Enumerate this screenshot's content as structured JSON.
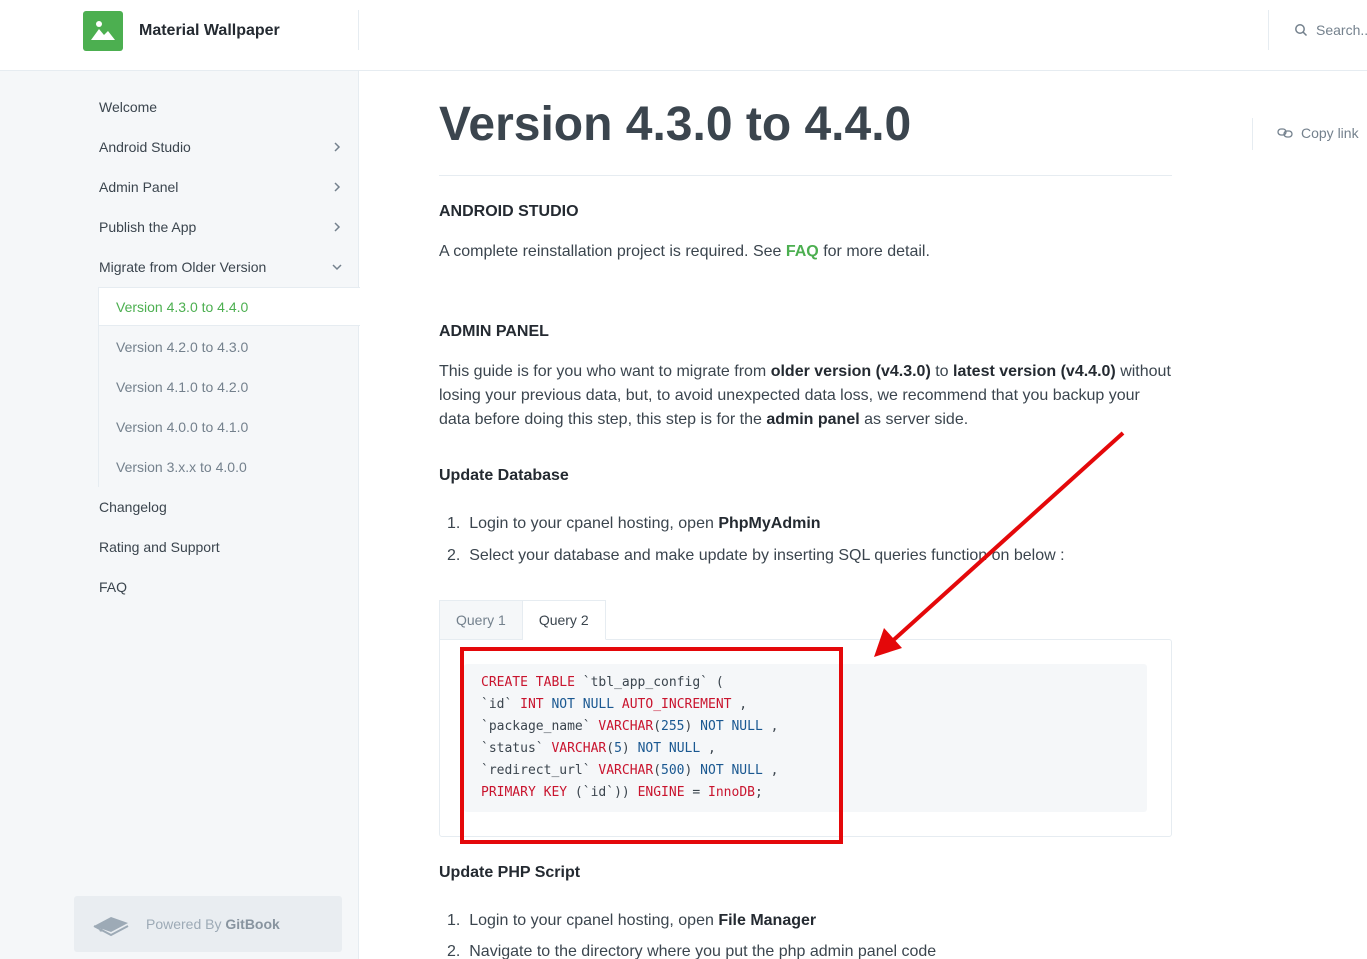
{
  "header": {
    "site_title": "Material Wallpaper",
    "search_placeholder": "Search..."
  },
  "sidebar": {
    "items": [
      {
        "label": "Welcome"
      },
      {
        "label": "Android Studio"
      },
      {
        "label": "Admin Panel"
      },
      {
        "label": "Publish the App"
      },
      {
        "label": "Migrate from Older Version"
      },
      {
        "label": "Changelog"
      },
      {
        "label": "Rating and Support"
      },
      {
        "label": "FAQ"
      }
    ],
    "subitems": [
      {
        "label": "Version 4.3.0 to 4.4.0",
        "active": true
      },
      {
        "label": "Version 4.2.0 to 4.3.0"
      },
      {
        "label": "Version 4.1.0 to 4.2.0"
      },
      {
        "label": "Version 4.0.0 to 4.1.0"
      },
      {
        "label": "Version 3.x.x to 4.0.0"
      }
    ],
    "powered_prefix": "Powered By ",
    "powered_brand": "GitBook"
  },
  "page": {
    "title": "Version 4.3.0 to 4.4.0",
    "copy_link": "Copy link",
    "android_heading": "ANDROID STUDIO",
    "android_text_pre": "A complete reinstallation project is required. See ",
    "android_link": "FAQ",
    "android_text_post": " for more detail.",
    "admin_heading": "ADMIN PANEL",
    "admin_p1": "This guide is for you who want to migrate from ",
    "admin_b1": "older version (v4.3.0)",
    "admin_p2": " to ",
    "admin_b2": "latest version (v4.4.0)",
    "admin_p3": " without losing your previous data, but, to avoid unexpected data loss, we recommend that you backup your data before doing this step, this step is for the ",
    "admin_b3": "admin panel",
    "admin_p4": " as server side.",
    "update_db_heading": "Update Database",
    "db_steps": [
      {
        "num": "1.",
        "text": "Login to your cpanel hosting, open ",
        "bold": "PhpMyAdmin"
      },
      {
        "num": "2.",
        "text": "Select your database and make update by inserting SQL queries function on below :",
        "bold": ""
      }
    ],
    "tabs": [
      "Query 1",
      "Query 2"
    ],
    "active_tab": "Query 2",
    "code_lines": [
      "CREATE TABLE `tbl_app_config` (",
      "`id` INT NOT NULL AUTO_INCREMENT ,",
      "`package_name` VARCHAR(255) NOT NULL ,",
      "`status` VARCHAR(5) NOT NULL ,",
      "`redirect_url` VARCHAR(500) NOT NULL ,",
      "PRIMARY KEY (`id`)) ENGINE = InnoDB;"
    ],
    "update_php_heading": "Update PHP Script",
    "php_steps": [
      {
        "num": "1.",
        "text": "Login to your cpanel hosting, open ",
        "bold": "File Manager"
      },
      {
        "num": "2.",
        "text": "Navigate to the directory where you put the php admin panel code",
        "bold": ""
      }
    ]
  },
  "colors": {
    "accent": "#4caf50",
    "annotation_red": "#e4080a",
    "sql_keyword": "#c9142e",
    "sql_keyword_alt": "#1a5891"
  }
}
